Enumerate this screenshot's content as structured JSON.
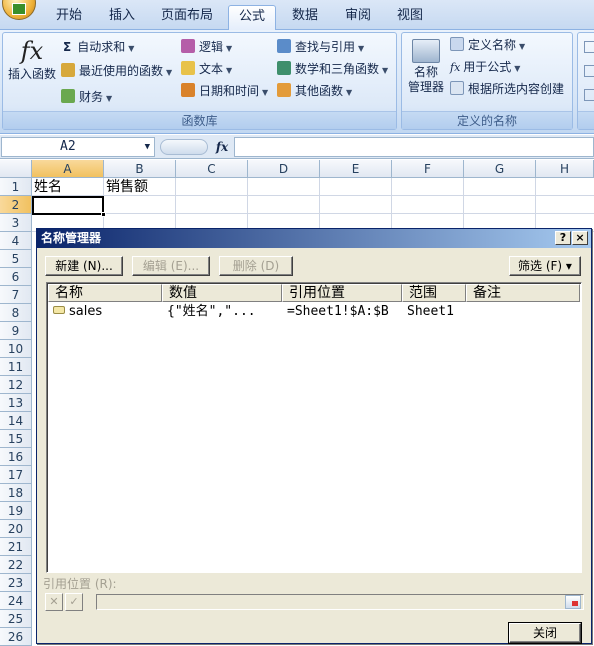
{
  "ribbon_tabs": [
    "开始",
    "插入",
    "页面布局",
    "公式",
    "数据",
    "审阅",
    "视图"
  ],
  "active_tab": "公式",
  "function_library": {
    "insert_function": "插入函数",
    "autosum": "自动求和",
    "recently_used": "最近使用的函数",
    "financial": "财务",
    "logical": "逻辑",
    "text": "文本",
    "date_time": "日期和时间",
    "lookup": "查找与引用",
    "math_trig": "数学和三角函数",
    "more_functions": "其他函数",
    "group_label": "函数库"
  },
  "defined_names": {
    "name_manager": "名称\n管理器",
    "define_name": "定义名称",
    "use_in_formula": "用于公式",
    "create_from_selection": "根据所选内容创建",
    "group_label": "定义的名称"
  },
  "formula_bar": {
    "name_box": "A2",
    "fx": "fx",
    "formula": ""
  },
  "sheet": {
    "columns": [
      "A",
      "B",
      "C",
      "D",
      "E",
      "F",
      "G",
      "H"
    ],
    "rows": [
      "1",
      "2",
      "3",
      "4",
      "5",
      "6",
      "7",
      "8",
      "9",
      "10",
      "11",
      "12",
      "13",
      "14",
      "15",
      "16",
      "17",
      "18",
      "19",
      "20",
      "21",
      "22",
      "23",
      "24",
      "25",
      "26"
    ],
    "cells": {
      "A1": "姓名",
      "B1": "销售额"
    },
    "active_cell": "A2"
  },
  "dialog": {
    "title": "名称管理器",
    "help": "?",
    "close_x": "×",
    "new_button": "新建 (N)...",
    "edit_button": "编辑 (E)...",
    "delete_button": "删除 (D)",
    "filter_button": "筛选 (F) ▾",
    "columns": [
      "名称",
      "数值",
      "引用位置",
      "范围",
      "备注"
    ],
    "items": [
      {
        "name": "sales",
        "value": "{\"姓名\",\"...",
        "refers_to": "=Sheet1!$A:$B",
        "scope": "Sheet1",
        "comment": ""
      }
    ],
    "refers_to_label": "引用位置 (R):",
    "refers_to_value": "",
    "cancel_symbol": "✕",
    "confirm_symbol": "✓",
    "close_button": "关闭"
  },
  "colors": {
    "ribbon_bg": "#d5e4f6",
    "dialog_title": "#0a246a",
    "dialog_bg": "#ece9d8",
    "selected_header": "#f1c15f"
  }
}
